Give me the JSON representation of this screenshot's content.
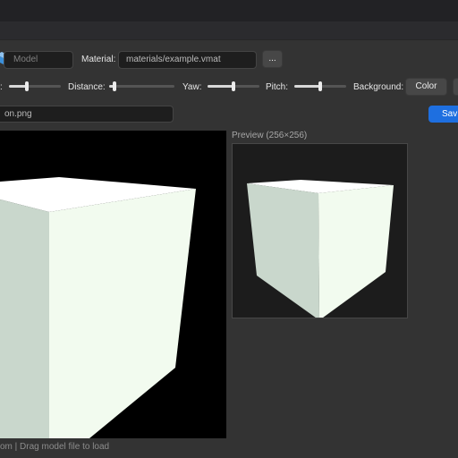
{
  "toolbar": {
    "model_placeholder": "Model",
    "material_label": "Material:",
    "material_value": "materials/example.vmat",
    "browse_label": "..."
  },
  "controls": {
    "fov_label": ":",
    "fov_level": 0.35,
    "distance_label": "Distance:",
    "distance_level": 0.08,
    "yaw_label": "Yaw:",
    "yaw_level": 0.5,
    "pitch_label": "Pitch:",
    "pitch_level": 0.5,
    "background_label": "Background:",
    "color_button_label": "Color"
  },
  "output": {
    "filename": "on.png",
    "save_button_label": "Sav"
  },
  "preview": {
    "label": "Preview (256×256)"
  },
  "status": {
    "text": "om | Drag model file to load"
  },
  "colors": {
    "accent": "#1e6fe0",
    "background": "#333333",
    "viewport": "#000000",
    "cube_top": "#ffffff",
    "cube_left": "#c9d7cc",
    "cube_right": "#f2fbef"
  }
}
